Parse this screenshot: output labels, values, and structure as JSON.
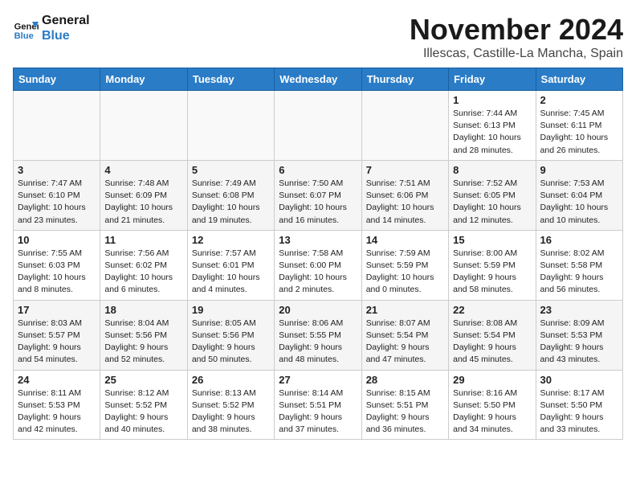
{
  "logo": {
    "line1": "General",
    "line2": "Blue"
  },
  "title": "November 2024",
  "location": "Illescas, Castille-La Mancha, Spain",
  "headers": [
    "Sunday",
    "Monday",
    "Tuesday",
    "Wednesday",
    "Thursday",
    "Friday",
    "Saturday"
  ],
  "weeks": [
    [
      {
        "day": "",
        "text": ""
      },
      {
        "day": "",
        "text": ""
      },
      {
        "day": "",
        "text": ""
      },
      {
        "day": "",
        "text": ""
      },
      {
        "day": "",
        "text": ""
      },
      {
        "day": "1",
        "text": "Sunrise: 7:44 AM\nSunset: 6:13 PM\nDaylight: 10 hours\nand 28 minutes."
      },
      {
        "day": "2",
        "text": "Sunrise: 7:45 AM\nSunset: 6:11 PM\nDaylight: 10 hours\nand 26 minutes."
      }
    ],
    [
      {
        "day": "3",
        "text": "Sunrise: 7:47 AM\nSunset: 6:10 PM\nDaylight: 10 hours\nand 23 minutes."
      },
      {
        "day": "4",
        "text": "Sunrise: 7:48 AM\nSunset: 6:09 PM\nDaylight: 10 hours\nand 21 minutes."
      },
      {
        "day": "5",
        "text": "Sunrise: 7:49 AM\nSunset: 6:08 PM\nDaylight: 10 hours\nand 19 minutes."
      },
      {
        "day": "6",
        "text": "Sunrise: 7:50 AM\nSunset: 6:07 PM\nDaylight: 10 hours\nand 16 minutes."
      },
      {
        "day": "7",
        "text": "Sunrise: 7:51 AM\nSunset: 6:06 PM\nDaylight: 10 hours\nand 14 minutes."
      },
      {
        "day": "8",
        "text": "Sunrise: 7:52 AM\nSunset: 6:05 PM\nDaylight: 10 hours\nand 12 minutes."
      },
      {
        "day": "9",
        "text": "Sunrise: 7:53 AM\nSunset: 6:04 PM\nDaylight: 10 hours\nand 10 minutes."
      }
    ],
    [
      {
        "day": "10",
        "text": "Sunrise: 7:55 AM\nSunset: 6:03 PM\nDaylight: 10 hours\nand 8 minutes."
      },
      {
        "day": "11",
        "text": "Sunrise: 7:56 AM\nSunset: 6:02 PM\nDaylight: 10 hours\nand 6 minutes."
      },
      {
        "day": "12",
        "text": "Sunrise: 7:57 AM\nSunset: 6:01 PM\nDaylight: 10 hours\nand 4 minutes."
      },
      {
        "day": "13",
        "text": "Sunrise: 7:58 AM\nSunset: 6:00 PM\nDaylight: 10 hours\nand 2 minutes."
      },
      {
        "day": "14",
        "text": "Sunrise: 7:59 AM\nSunset: 5:59 PM\nDaylight: 10 hours\nand 0 minutes."
      },
      {
        "day": "15",
        "text": "Sunrise: 8:00 AM\nSunset: 5:59 PM\nDaylight: 9 hours\nand 58 minutes."
      },
      {
        "day": "16",
        "text": "Sunrise: 8:02 AM\nSunset: 5:58 PM\nDaylight: 9 hours\nand 56 minutes."
      }
    ],
    [
      {
        "day": "17",
        "text": "Sunrise: 8:03 AM\nSunset: 5:57 PM\nDaylight: 9 hours\nand 54 minutes."
      },
      {
        "day": "18",
        "text": "Sunrise: 8:04 AM\nSunset: 5:56 PM\nDaylight: 9 hours\nand 52 minutes."
      },
      {
        "day": "19",
        "text": "Sunrise: 8:05 AM\nSunset: 5:56 PM\nDaylight: 9 hours\nand 50 minutes."
      },
      {
        "day": "20",
        "text": "Sunrise: 8:06 AM\nSunset: 5:55 PM\nDaylight: 9 hours\nand 48 minutes."
      },
      {
        "day": "21",
        "text": "Sunrise: 8:07 AM\nSunset: 5:54 PM\nDaylight: 9 hours\nand 47 minutes."
      },
      {
        "day": "22",
        "text": "Sunrise: 8:08 AM\nSunset: 5:54 PM\nDaylight: 9 hours\nand 45 minutes."
      },
      {
        "day": "23",
        "text": "Sunrise: 8:09 AM\nSunset: 5:53 PM\nDaylight: 9 hours\nand 43 minutes."
      }
    ],
    [
      {
        "day": "24",
        "text": "Sunrise: 8:11 AM\nSunset: 5:53 PM\nDaylight: 9 hours\nand 42 minutes."
      },
      {
        "day": "25",
        "text": "Sunrise: 8:12 AM\nSunset: 5:52 PM\nDaylight: 9 hours\nand 40 minutes."
      },
      {
        "day": "26",
        "text": "Sunrise: 8:13 AM\nSunset: 5:52 PM\nDaylight: 9 hours\nand 38 minutes."
      },
      {
        "day": "27",
        "text": "Sunrise: 8:14 AM\nSunset: 5:51 PM\nDaylight: 9 hours\nand 37 minutes."
      },
      {
        "day": "28",
        "text": "Sunrise: 8:15 AM\nSunset: 5:51 PM\nDaylight: 9 hours\nand 36 minutes."
      },
      {
        "day": "29",
        "text": "Sunrise: 8:16 AM\nSunset: 5:50 PM\nDaylight: 9 hours\nand 34 minutes."
      },
      {
        "day": "30",
        "text": "Sunrise: 8:17 AM\nSunset: 5:50 PM\nDaylight: 9 hours\nand 33 minutes."
      }
    ]
  ]
}
